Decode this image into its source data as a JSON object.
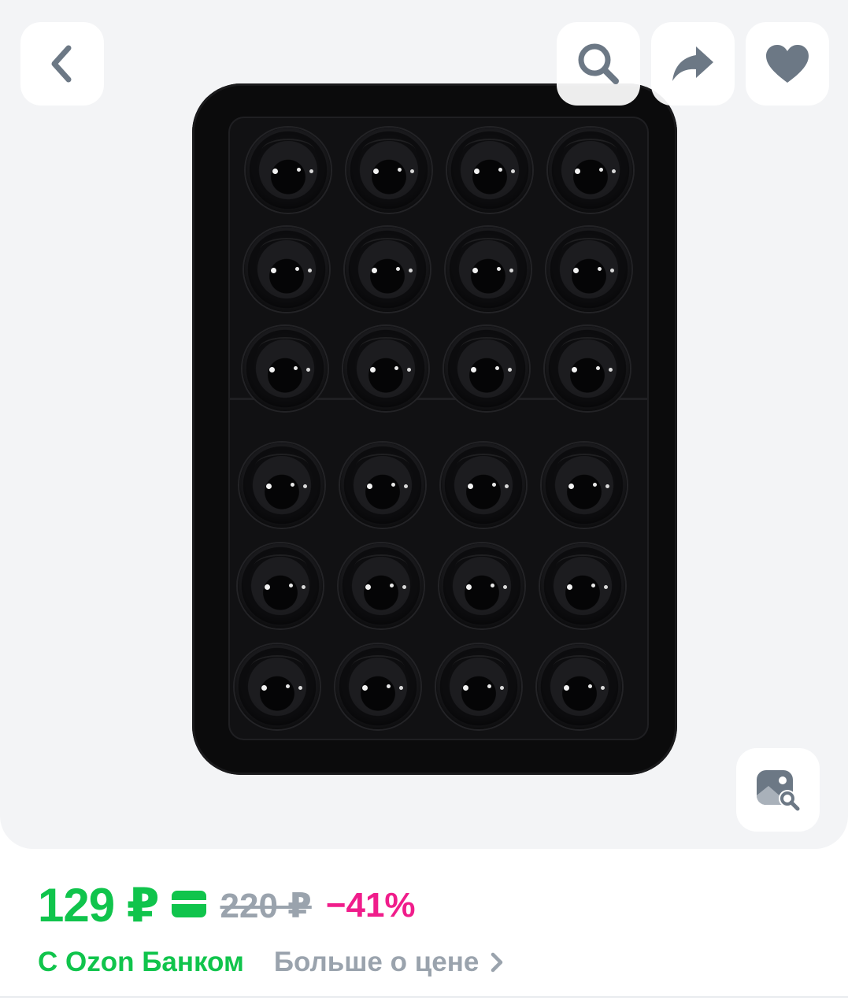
{
  "icons": {
    "back": "chevron-left-icon",
    "search": "search-icon",
    "share": "share-icon",
    "favorite": "heart-icon",
    "photo_search": "image-search-icon",
    "card": "card-icon",
    "more": "chevron-right-icon"
  },
  "colors": {
    "price_green": "#10c44c",
    "discount_pink": "#f01d8b",
    "muted_gray": "#9aa3ad",
    "icon_gray": "#6c7885"
  },
  "product_image": {
    "alt_semantic": "black silicone suction cup phone mount pad",
    "rows": 6,
    "cols": 4
  },
  "price": {
    "current": "129 ₽",
    "old": "220 ₽",
    "discount": "−41%"
  },
  "bank": {
    "label": "С Ozon Банком",
    "more_link": "Больше о цене"
  }
}
